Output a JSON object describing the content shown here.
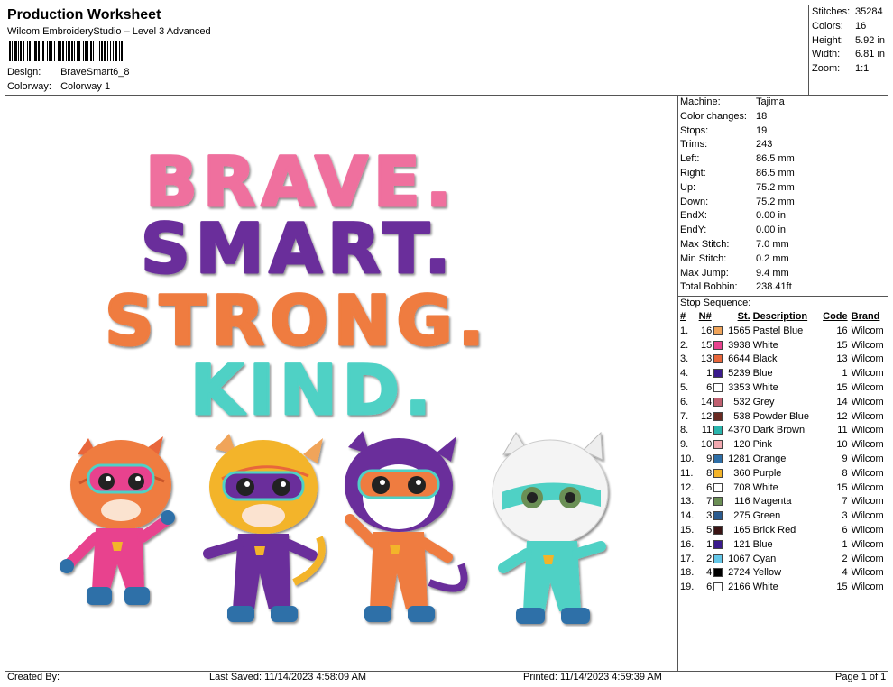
{
  "header": {
    "title": "Production Worksheet",
    "software": "Wilcom EmbroideryStudio – Level 3 Advanced",
    "design_label": "Design:",
    "design_value": "BraveSmart6_8",
    "colorway_label": "Colorway:",
    "colorway_value": "Colorway 1"
  },
  "summary": [
    {
      "label": "Stitches:",
      "value": "35284"
    },
    {
      "label": "Colors:",
      "value": "16"
    },
    {
      "label": "Height:",
      "value": "5.92 in"
    },
    {
      "label": "Width:",
      "value": "6.81 in"
    },
    {
      "label": "Zoom:",
      "value": "1:1"
    }
  ],
  "design": {
    "words": [
      "BRAVE.",
      "SMART.",
      "STRONG.",
      "KIND."
    ],
    "colors": {
      "brave": "#ef6f9e",
      "smart": "#6a2e9b",
      "strong": "#ef7b3f",
      "kind": "#4fd1c5"
    }
  },
  "machine": [
    {
      "label": "Machine:",
      "value": "Tajima"
    },
    {
      "label": "Color changes:",
      "value": "18"
    },
    {
      "label": "Stops:",
      "value": "19"
    },
    {
      "label": "Trims:",
      "value": "243"
    },
    {
      "label": "Left:",
      "value": "86.5 mm"
    },
    {
      "label": "Right:",
      "value": "86.5 mm"
    },
    {
      "label": "Up:",
      "value": "75.2 mm"
    },
    {
      "label": "Down:",
      "value": "75.2 mm"
    },
    {
      "label": "EndX:",
      "value": "0.00 in"
    },
    {
      "label": "EndY:",
      "value": "0.00 in"
    },
    {
      "label": "Max Stitch:",
      "value": "7.0 mm"
    },
    {
      "label": "Min Stitch:",
      "value": "0.2 mm"
    },
    {
      "label": "Max Jump:",
      "value": "9.4 mm"
    },
    {
      "label": "Total Bobbin:",
      "value": "238.41ft"
    }
  ],
  "stop_sequence": {
    "label": "Stop Sequence:",
    "headers": {
      "idx": "#",
      "n": "N#",
      "st": "St.",
      "desc": "Description",
      "code": "Code",
      "brand": "Brand"
    },
    "rows": [
      {
        "idx": "1.",
        "n": "16",
        "color": "#f0a45a",
        "st": "1565",
        "desc": "Pastel Blue",
        "code": "16",
        "brand": "Wilcom"
      },
      {
        "idx": "2.",
        "n": "15",
        "color": "#e8428e",
        "st": "3938",
        "desc": "White",
        "code": "15",
        "brand": "Wilcom"
      },
      {
        "idx": "3.",
        "n": "13",
        "color": "#e8663a",
        "st": "6644",
        "desc": "Black",
        "code": "13",
        "brand": "Wilcom"
      },
      {
        "idx": "4.",
        "n": "1",
        "color": "#3a1a8c",
        "st": "5239",
        "desc": "Blue",
        "code": "1",
        "brand": "Wilcom"
      },
      {
        "idx": "5.",
        "n": "6",
        "color": "#ffffff",
        "st": "3353",
        "desc": "White",
        "code": "15",
        "brand": "Wilcom"
      },
      {
        "idx": "6.",
        "n": "14",
        "color": "#c06070",
        "st": "532",
        "desc": "Grey",
        "code": "14",
        "brand": "Wilcom"
      },
      {
        "idx": "7.",
        "n": "12",
        "color": "#6a2a22",
        "st": "538",
        "desc": "Powder Blue",
        "code": "12",
        "brand": "Wilcom"
      },
      {
        "idx": "8.",
        "n": "11",
        "color": "#2ab5ad",
        "st": "4370",
        "desc": "Dark Brown",
        "code": "11",
        "brand": "Wilcom"
      },
      {
        "idx": "9.",
        "n": "10",
        "color": "#f2a9b0",
        "st": "120",
        "desc": "Pink",
        "code": "10",
        "brand": "Wilcom"
      },
      {
        "idx": "10.",
        "n": "9",
        "color": "#2d6fa8",
        "st": "1281",
        "desc": "Orange",
        "code": "9",
        "brand": "Wilcom"
      },
      {
        "idx": "11.",
        "n": "8",
        "color": "#f3b429",
        "st": "360",
        "desc": "Purple",
        "code": "8",
        "brand": "Wilcom"
      },
      {
        "idx": "12.",
        "n": "6",
        "color": "#ffffff",
        "st": "708",
        "desc": "White",
        "code": "15",
        "brand": "Wilcom"
      },
      {
        "idx": "13.",
        "n": "7",
        "color": "#6b8f55",
        "st": "116",
        "desc": "Magenta",
        "code": "7",
        "brand": "Wilcom"
      },
      {
        "idx": "14.",
        "n": "3",
        "color": "#2a5b8f",
        "st": "275",
        "desc": "Green",
        "code": "3",
        "brand": "Wilcom"
      },
      {
        "idx": "15.",
        "n": "5",
        "color": "#3a1414",
        "st": "165",
        "desc": "Brick Red",
        "code": "6",
        "brand": "Wilcom"
      },
      {
        "idx": "16.",
        "n": "1",
        "color": "#3a1a8c",
        "st": "121",
        "desc": "Blue",
        "code": "1",
        "brand": "Wilcom"
      },
      {
        "idx": "17.",
        "n": "2",
        "color": "#63c7e8",
        "st": "1067",
        "desc": "Cyan",
        "code": "2",
        "brand": "Wilcom"
      },
      {
        "idx": "18.",
        "n": "4",
        "color": "#000000",
        "st": "2724",
        "desc": "Yellow",
        "code": "4",
        "brand": "Wilcom"
      },
      {
        "idx": "19.",
        "n": "6",
        "color": "#ffffff",
        "st": "2166",
        "desc": "White",
        "code": "15",
        "brand": "Wilcom"
      }
    ]
  },
  "footer": {
    "created_by": "Created By:",
    "last_saved": "Last Saved: 11/14/2023 4:58:09 AM",
    "printed": "Printed: 11/14/2023 4:59:39 AM",
    "page": "Page 1 of 1"
  }
}
